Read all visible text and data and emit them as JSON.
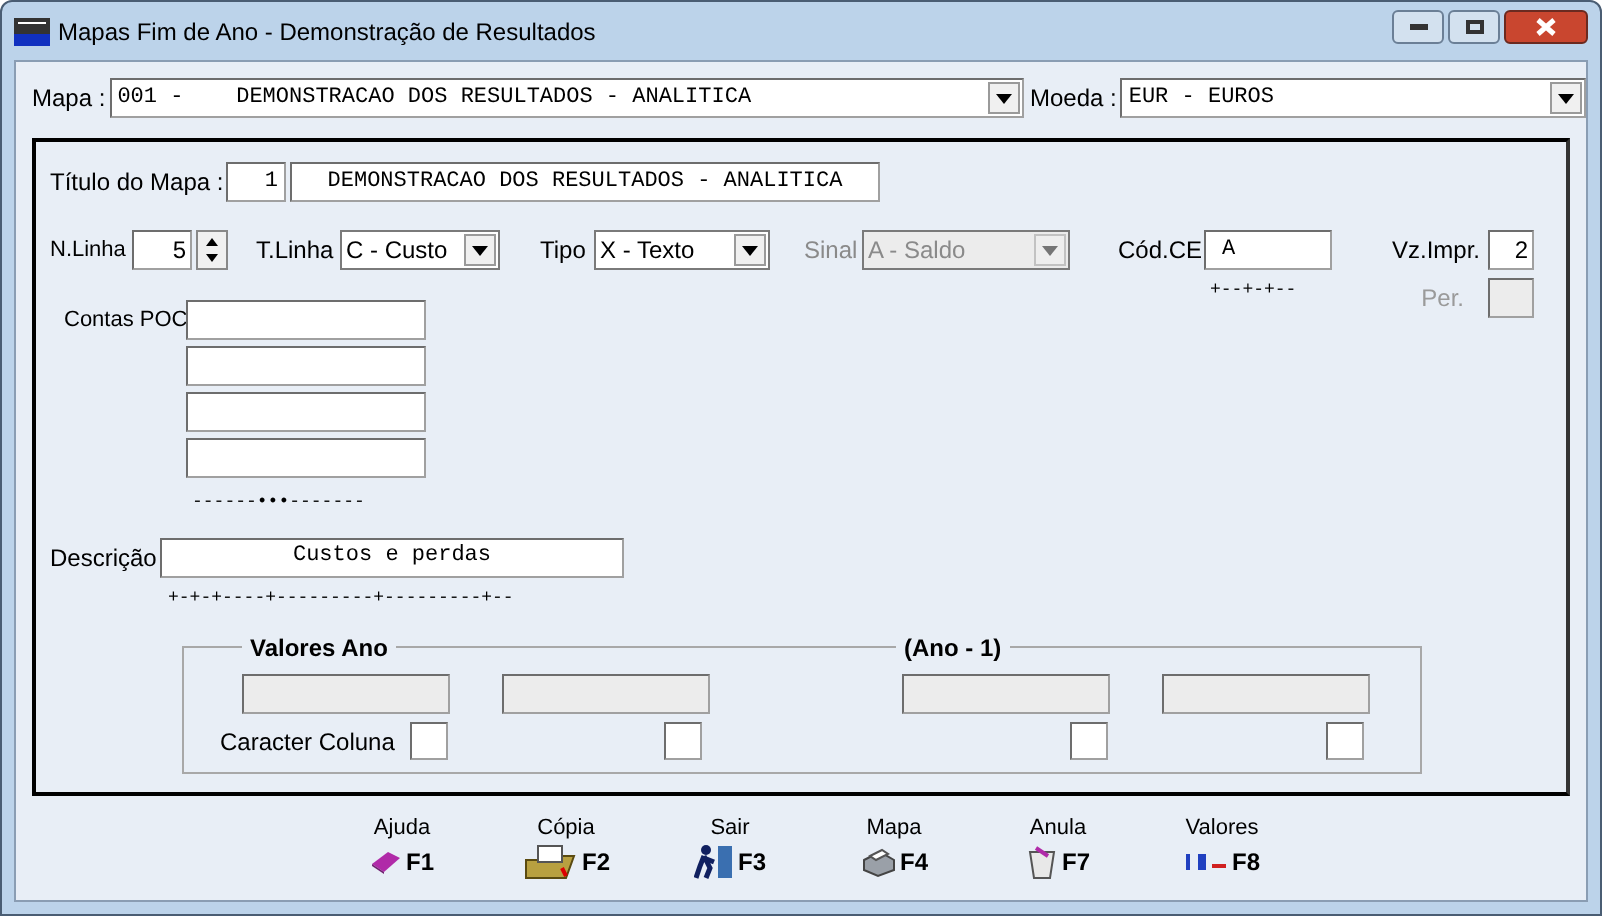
{
  "window": {
    "title": "Mapas Fim de Ano - Demonstração de Resultados"
  },
  "mapa": {
    "label": "Mapa :",
    "value": "001 -    DEMONSTRACAO DOS RESULTADOS - ANALITICA"
  },
  "moeda": {
    "label": "Moeda :",
    "value": "EUR - EUROS"
  },
  "titulo": {
    "label": "Título do Mapa :",
    "number": "1",
    "value": "DEMONSTRACAO DOS RESULTADOS - ANALITICA"
  },
  "n_linha": {
    "label": "N.Linha",
    "value": "5"
  },
  "t_linha": {
    "label": "T.Linha",
    "value": "C - Custo",
    "disabled": false
  },
  "tipo": {
    "label": "Tipo",
    "value": "X - Texto",
    "disabled": false
  },
  "sinal": {
    "label": "Sinal",
    "value": "A - Saldo",
    "disabled": true
  },
  "cod_ce": {
    "label": "Cód.CE",
    "value": "A",
    "mask": "+--+-+--"
  },
  "vz_impr": {
    "label": "Vz.Impr.",
    "value": "2"
  },
  "per": {
    "label": "Per.",
    "disabled": true
  },
  "contas_poc": {
    "label": "Contas POC",
    "mask": "------•••-------"
  },
  "descricao": {
    "label": "Descrição",
    "value": "Custos e perdas",
    "mask": "+-+-+----+---------+---------+--"
  },
  "valores": {
    "headings": [
      "Valores Ano",
      "(Ano - 1)"
    ],
    "caracter_label": "Caracter Coluna",
    "columns": [
      {
        "checked": false
      },
      {
        "checked": false
      },
      {
        "checked": false
      },
      {
        "checked": false
      }
    ]
  },
  "footer": [
    {
      "label": "Ajuda",
      "key": "F1",
      "kind": "help"
    },
    {
      "label": "Cópia",
      "key": "F2",
      "kind": "copy"
    },
    {
      "label": "Sair",
      "key": "F3",
      "kind": "exit"
    },
    {
      "label": "Mapa",
      "key": "F4",
      "kind": "print"
    },
    {
      "label": "Anula",
      "key": "F7",
      "kind": "cancel"
    },
    {
      "label": "Valores",
      "key": "F8",
      "kind": "values"
    }
  ]
}
